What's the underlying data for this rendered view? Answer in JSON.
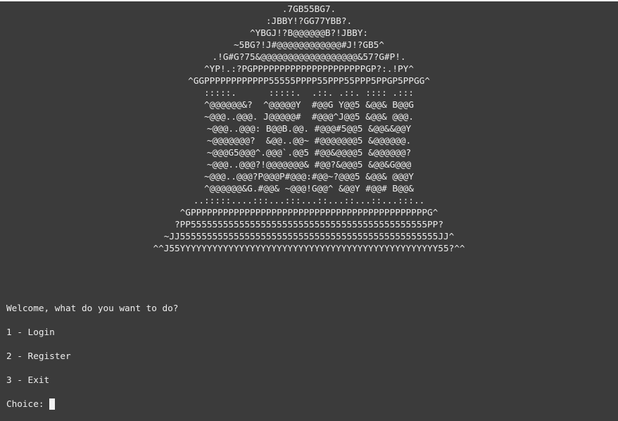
{
  "terminal": {
    "art_lines": [
      ".7GB55BG7.",
      ":JBBY!?GG77YBB?.",
      "^YBGJ!?B@@@@@@B?!JBBY:",
      "~5BG?!J#@@@@@@@@@@@@#J!?GB5^",
      ".!G#G?75&@@@@@@@@@@@@@@@@@@&57?G#P!.",
      "^YP!.:?PGPPPPPPPPPPPPPPPPPPPPPGP?:.!PY^",
      "^GGPPPPPPPPPPPP55555PPPP55PPP55PPP5PPGP5PPGG^",
      ":::::.      :::::.  .::. .::. :::: .:::",
      "^@@@@@@&?  ^@@@@@Y  #@@G Y@@5 &@@& B@@G",
      "~@@@..@@@. J@@@@@#  #@@@^J@@5 &@@& @@@.",
      "~@@@..@@@: B@@B.@@. #@@@#5@@5 &@@&&@@Y",
      "~@@@@@@@?  &@@..@@~ #@@@@@@@5 &@@@@@@.",
      "~@@@G5@@@^.@@@`.@@5 #@@&@@@@5 &@@@@@@?",
      "~@@@..@@@?!@@@@@@@& #@@?&@@@5 &@@&G@@@",
      "~@@@..@@@?P@@@P#@@@:#@@~?@@@5 &@@& @@@Y",
      "^@@@@@@&G.#@@& ~@@@!G@@^ &@@Y #@@# B@@&",
      "..:::::....:::...:::...::...::...::...:::..",
      "^GPPPPPPPPPPPPPPPPPPPPPPPPPPPPPPPPPPPPPPPPPPPPG^",
      "?PP55555555555555555555555555555555555555555555PP?",
      "~JJ555555555555555555555555555555555555555555555555JJ^",
      "^^J55YYYYYYYYYYYYYYYYYYYYYYYYYYYYYYYYYYYYYYYYYYYYYYYY55?^^"
    ],
    "prompt": "Welcome, what do you want to do?",
    "options": [
      "1 - Login",
      "2 - Register",
      "3 - Exit"
    ],
    "choice_label": "Choice: "
  }
}
